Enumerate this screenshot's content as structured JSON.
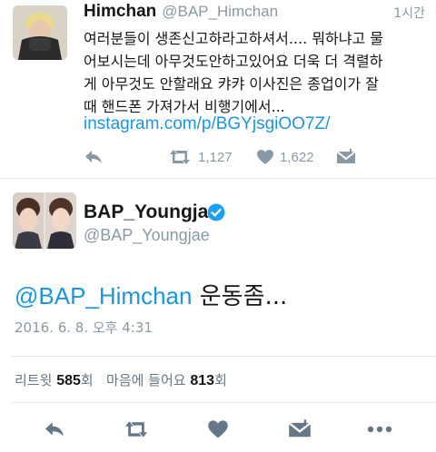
{
  "reply_tweet": {
    "display_name": "Himchan",
    "handle": "@BAP_Himchan",
    "time": "1시간",
    "text_lines": [
      "여러분들이 생존신고하라고하셔서.... 뭐하냐고 물",
      "어보시는데 아무것도안하고있어요 더욱 더 격렬하",
      "게 아무것도 안할래요 캬캬 이사진은 종업이가 잘",
      "때 핸드폰 가져가서 비행기에서..."
    ],
    "link": "instagram.com/p/BGYjsgiOO7Z/",
    "retweet_count": "1,127",
    "like_count": "1,622"
  },
  "main_tweet": {
    "display_name": "BAP_Youngjae",
    "handle": "@BAP_Youngjae",
    "mention": "@BAP_Himchan",
    "body": " 운동좀...",
    "timestamp": "2016. 6. 8. 오후 4:31",
    "stats": {
      "retweet_label": "리트윗",
      "retweet_count": "585",
      "retweet_unit": "회",
      "like_label": "마음에 들어요",
      "like_count": "813",
      "like_unit": "회"
    }
  },
  "colors": {
    "accent": "#1b95e0",
    "muted": "#8899a6",
    "icon": "#8899a6",
    "icon_dark": "#657786",
    "divider": "#e1e8ed",
    "verified": "#1da1f2"
  },
  "icons": {
    "reply": "reply-icon",
    "retweet": "retweet-icon",
    "like": "heart-icon",
    "dm": "envelope-icon",
    "more": "more-dots-icon",
    "verified": "verified-badge-icon"
  }
}
